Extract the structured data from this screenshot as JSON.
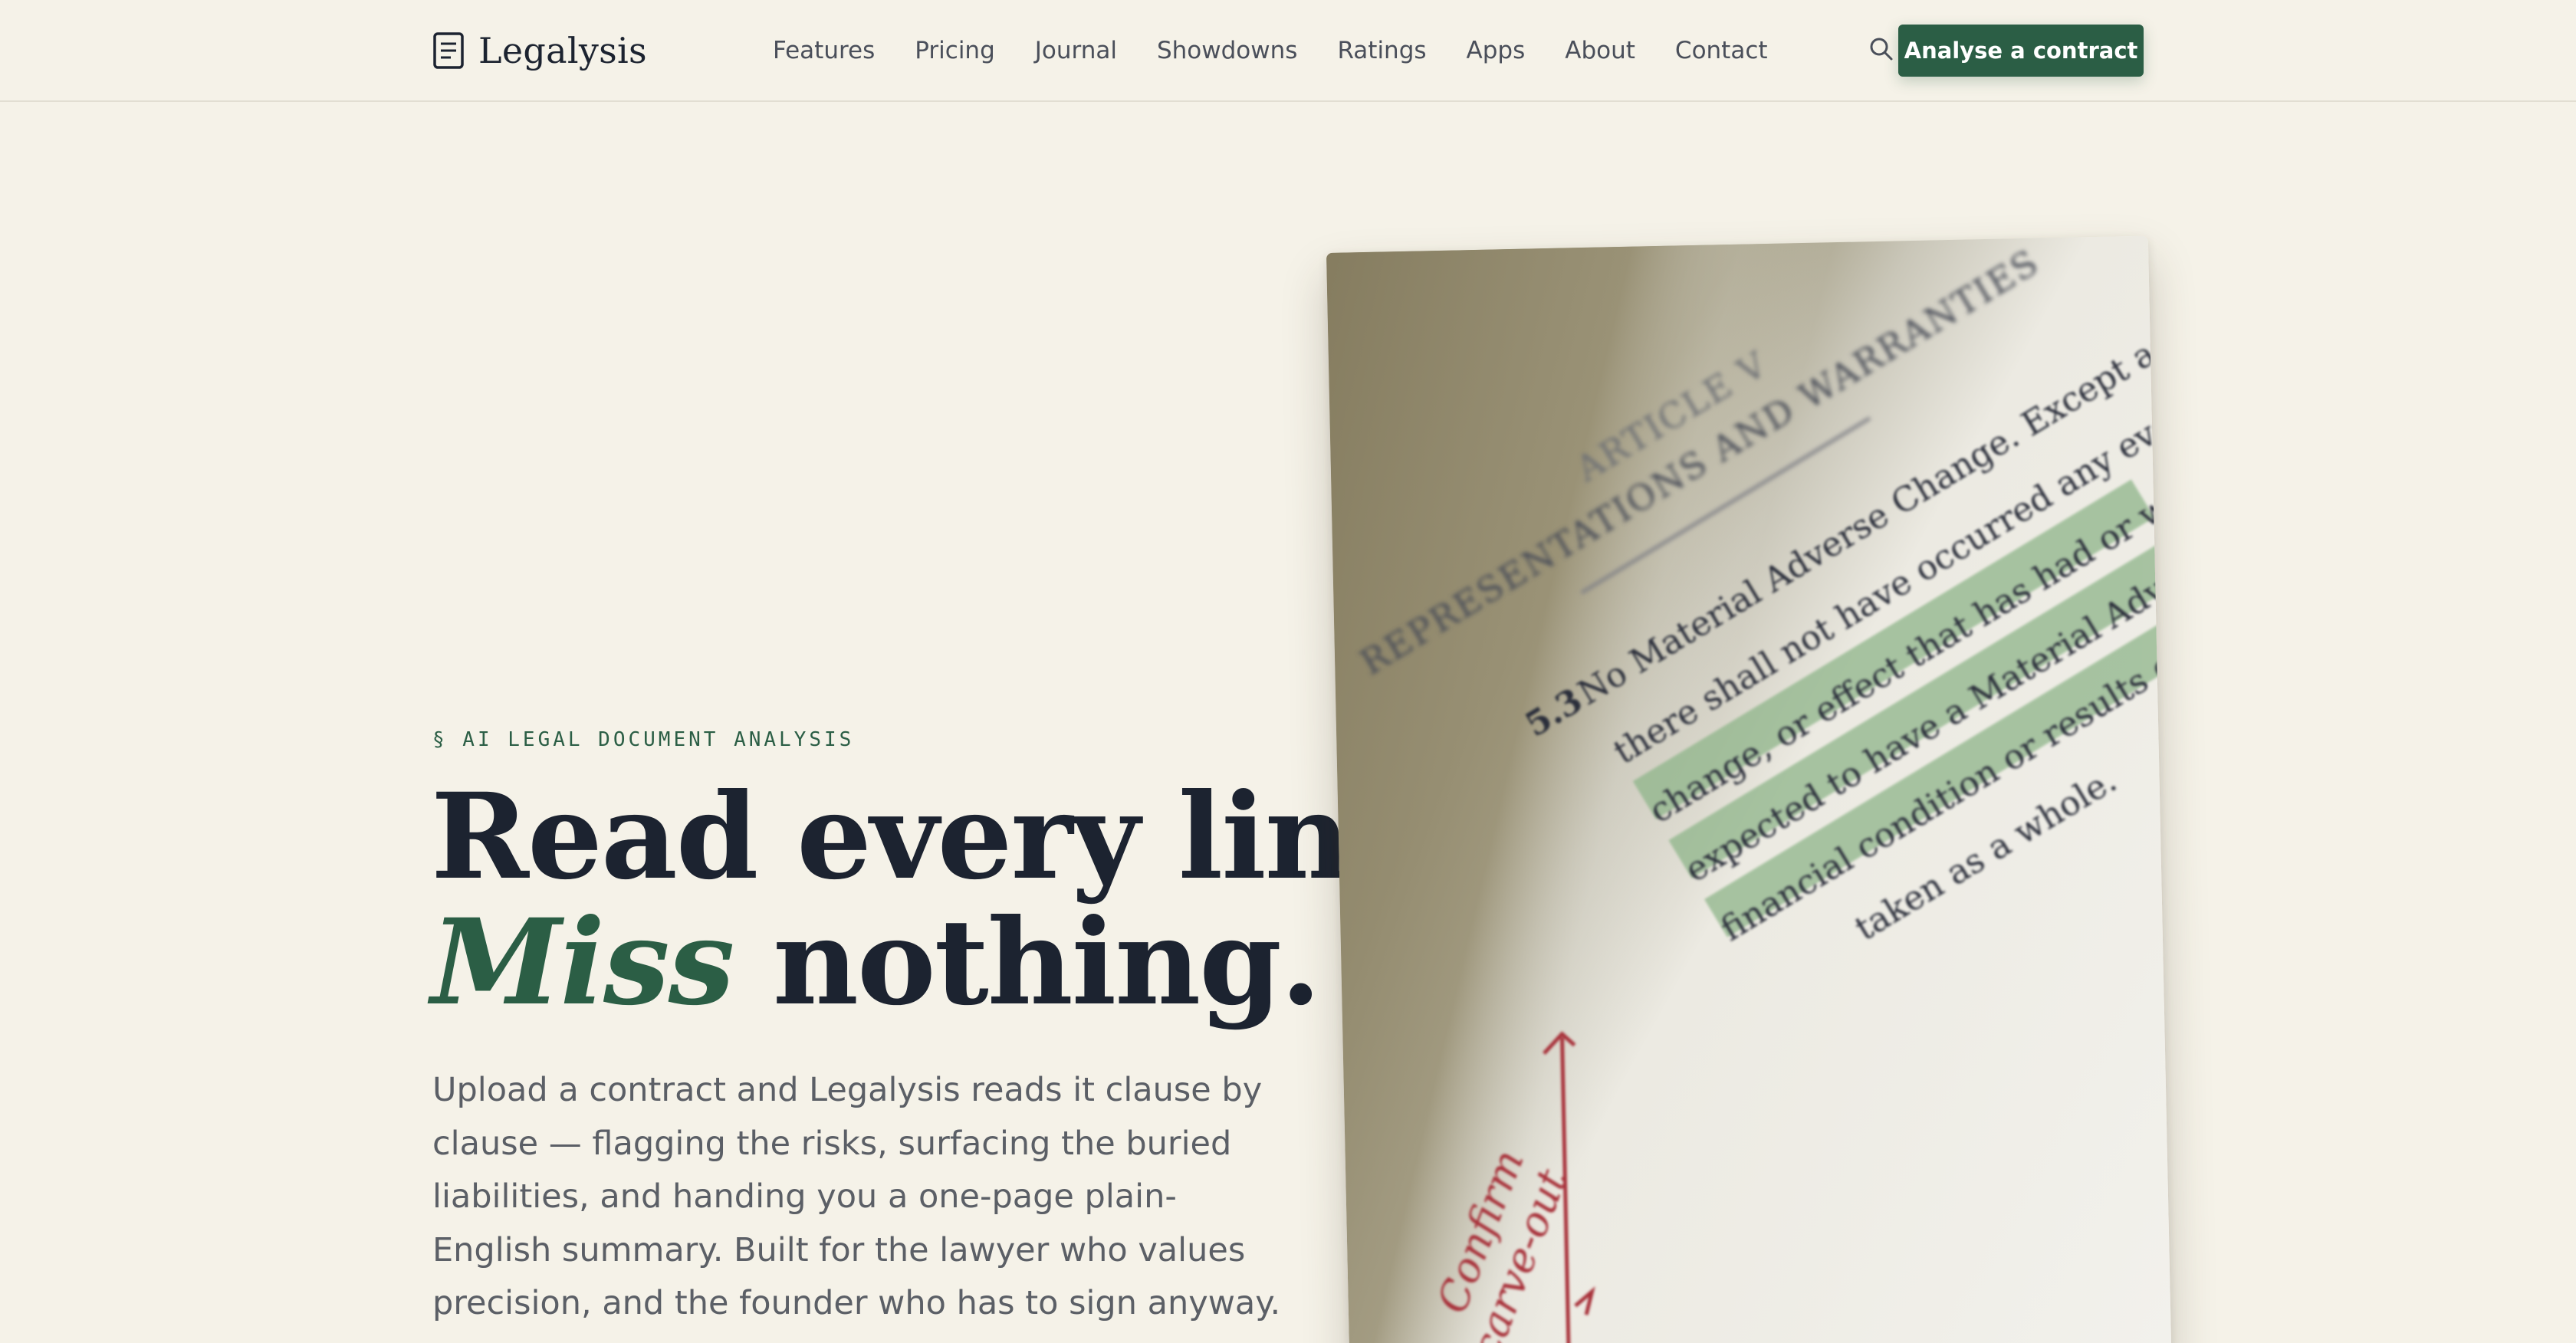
{
  "brand": {
    "name": "Legalysis"
  },
  "nav": {
    "items": [
      "Features",
      "Pricing",
      "Journal",
      "Showdowns",
      "Ratings",
      "Apps",
      "About",
      "Contact"
    ],
    "cta_label": "Analyse a contract"
  },
  "hero": {
    "eyebrow": "§ AI LEGAL DOCUMENT ANALYSIS",
    "headline_line1": "Read every line.",
    "headline_accent": "Miss",
    "headline_line2_rest": " nothing.",
    "subcopy": "Upload a contract and Legalysis reads it clause by clause — flagging the risks, surfacing the buried liabilities, and handing you a one-page plain-English summary. Built for the lawyer who values precision, and the founder who has to sign anyway."
  },
  "document": {
    "article": "ARTICLE V",
    "section_title": "REPRESENTATIONS AND WARRANTIES",
    "clause_number": "5.3",
    "lines": [
      "No Material Adverse Change. Except as set forth on",
      "there shall not have occurred any event, development",
      "change, or effect that has had or would reasonably be",
      "expected to have a Material Adverse Effect on the business,",
      "financial condition or results of operations of the",
      "taken as a whole."
    ],
    "margin_note_1": "Confirm",
    "margin_note_2": "carve-out"
  },
  "colors": {
    "background": "#f5f2e8",
    "accent": "#2b5e45",
    "text": "#1c2330",
    "muted": "#5b5f66",
    "highlight": "#8fb58a",
    "annotation": "#a8323a"
  }
}
